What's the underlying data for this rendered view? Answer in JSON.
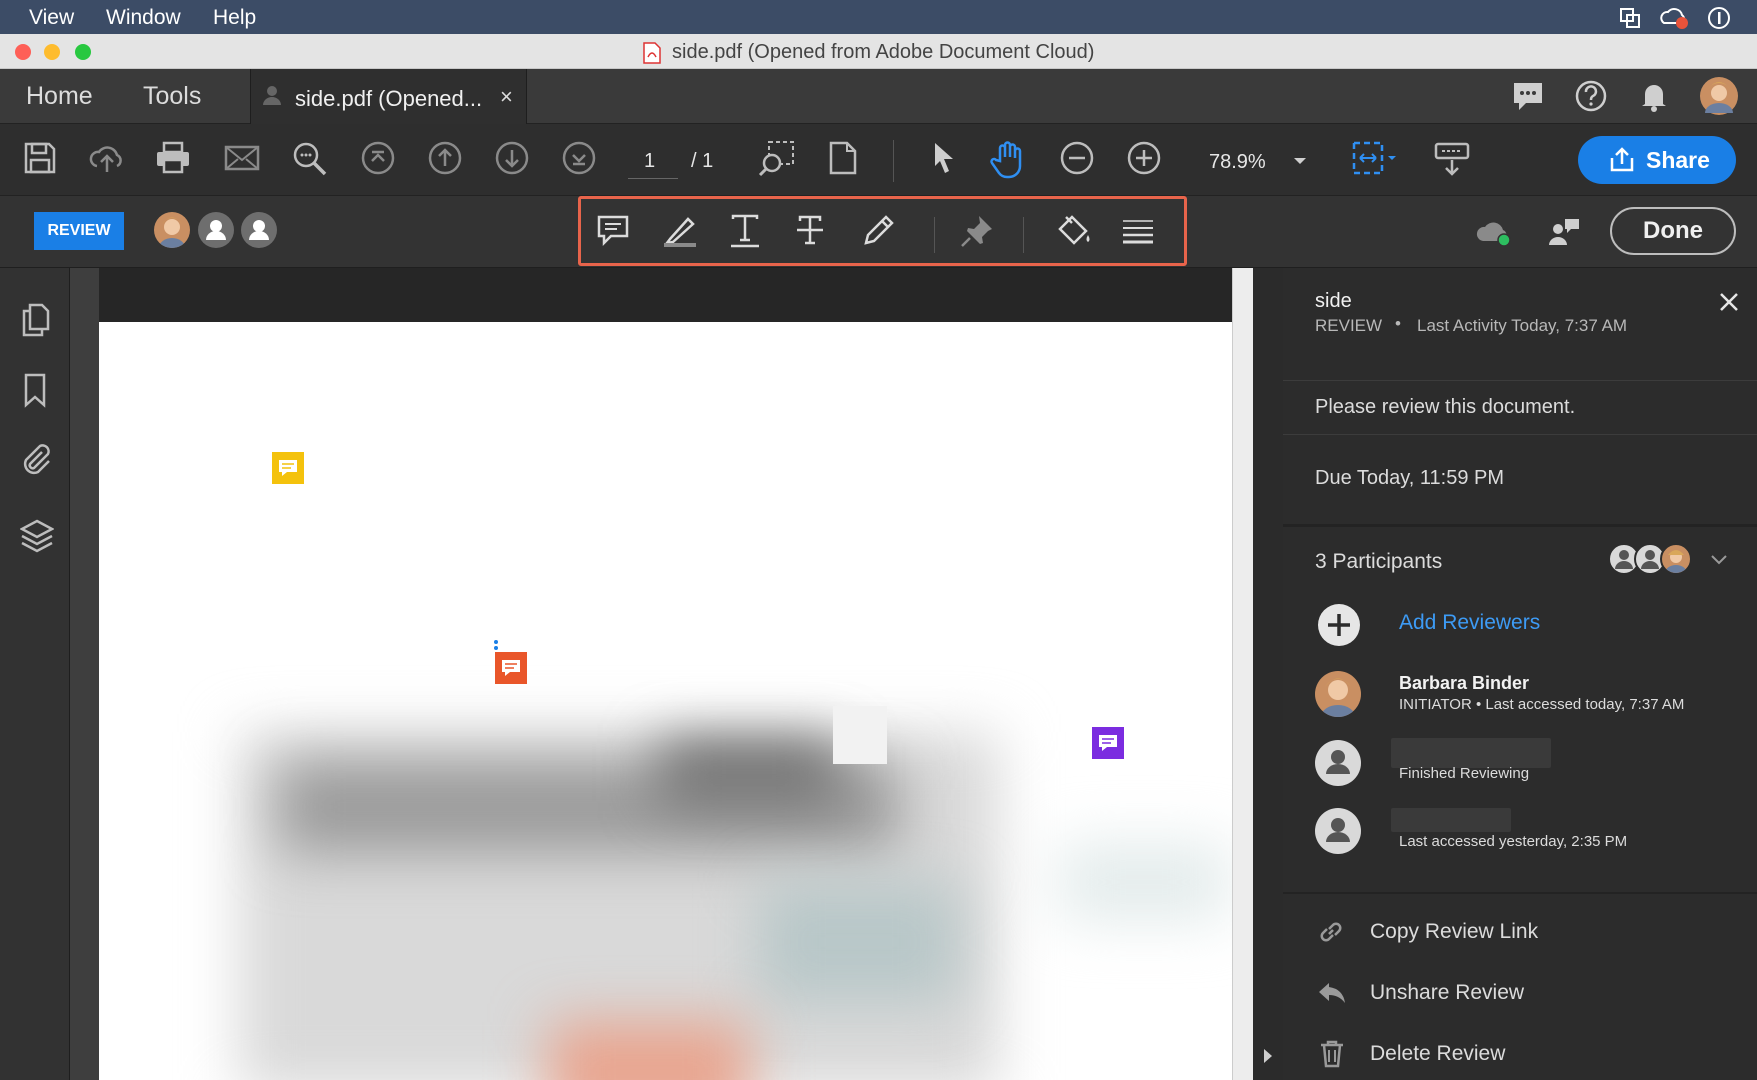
{
  "menubar": {
    "items": [
      "View",
      "Window",
      "Help"
    ]
  },
  "titlebar": {
    "title": "side.pdf (Opened from Adobe Document Cloud)"
  },
  "tabs": {
    "home": "Home",
    "tools": "Tools",
    "document": "side.pdf (Opened...",
    "close": "×"
  },
  "toolbar": {
    "page_current": "1",
    "page_total": "/ 1",
    "zoom": "78.9%",
    "share_label": "Share"
  },
  "review_bar": {
    "badge": "REVIEW",
    "done_label": "Done"
  },
  "panel": {
    "doc_name": "side",
    "status": "REVIEW",
    "bullet": "•",
    "last_activity": "Last Activity Today, 7:37 AM",
    "message": "Please review this document.",
    "due": "Due Today, 11:59 PM",
    "participants_label": "3 Participants",
    "add_reviewers": "Add Reviewers",
    "participants": [
      {
        "name": "Barbara Binder",
        "detail": "INITIATOR • Last accessed today, 7:37 AM"
      },
      {
        "name": "",
        "detail": "Finished Reviewing"
      },
      {
        "name": "",
        "detail": "Last accessed yesterday, 2:35 PM"
      }
    ],
    "actions": {
      "copy_link": "Copy Review Link",
      "unshare": "Unshare Review",
      "delete": "Delete Review"
    }
  },
  "colors": {
    "accent": "#1a7fe6",
    "highlight_box": "#e8644b",
    "sticky_yellow": "#f4c20d",
    "sticky_orange": "#e9562a",
    "sticky_purple": "#7b2ce0"
  }
}
